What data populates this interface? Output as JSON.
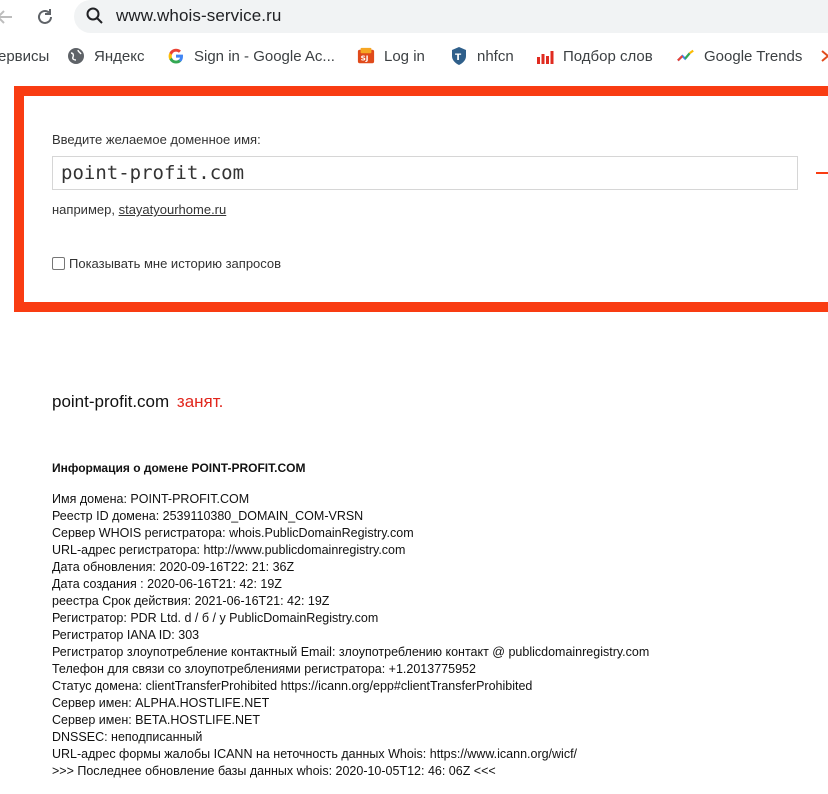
{
  "browser": {
    "url": "www.whois-service.ru",
    "bookmarks": [
      {
        "label": "ервисы",
        "icon": "apps-icon"
      },
      {
        "label": "Яндекс",
        "icon": "globe-icon"
      },
      {
        "label": "Sign in - Google Ac...",
        "icon": "google-icon"
      },
      {
        "label": "Log in",
        "icon": "site-icon"
      },
      {
        "label": "nhfcn",
        "icon": "badge-icon"
      },
      {
        "label": "Подбор слов",
        "icon": "bar-chart-icon"
      },
      {
        "label": "Google Trends",
        "icon": "trends-icon"
      }
    ]
  },
  "form": {
    "label": "Введите желаемое доменное имя:",
    "input_value": "point-profit.com",
    "example_prefix": "например,",
    "example_link": "stayatyourhome.ru",
    "history_label": "Показывать мне историю запросов",
    "history_checked": false
  },
  "result": {
    "domain": "point-profit.com",
    "status": "занят."
  },
  "info": {
    "heading": "Информация о домене POINT-PROFIT.COM",
    "lines": [
      "Имя домена: POINT-PROFIT.COM",
      "Реестр ID домена: 2539110380_DOMAIN_COM-VRSN",
      "Сервер WHOIS регистратора: whois.PublicDomainRegistry.com",
      "URL-адрес регистратора: http://www.publicdomainregistry.com",
      "Дата обновления: 2020-09-16T22: 21: 36Z",
      "Дата создания : 2020-06-16T21: 42: 19Z",
      "реестра Срок действия: 2021-06-16T21: 42: 19Z",
      "Регистратор: PDR Ltd. d / б / у PublicDomainRegistry.com",
      "Регистратор IANA ID: 303",
      "Регистратор злоупотребление контактный Email: злоупотреблению контакт @ publicdomainregistry.com",
      "Телефон для связи со злоупотреблениями регистратора: +1.2013775952",
      "Статус домена: clientTransferProhibited https://icann.org/epp#clientTransferProhibited",
      "Сервер имен: ALPHA.HOSTLIFE.NET",
      "Сервер имен: BETA.HOSTLIFE.NET",
      "DNSSEC: неподписанный",
      "URL-адрес формы жалобы ICANN на неточность данных Whois: https://www.icann.org/wicf/",
      ">>> Последнее обновление базы данных whois: 2020-10-05T12: 46: 06Z <<<"
    ]
  },
  "colors": {
    "accent_border": "#f93c12",
    "taken_status": "#e1261c"
  }
}
